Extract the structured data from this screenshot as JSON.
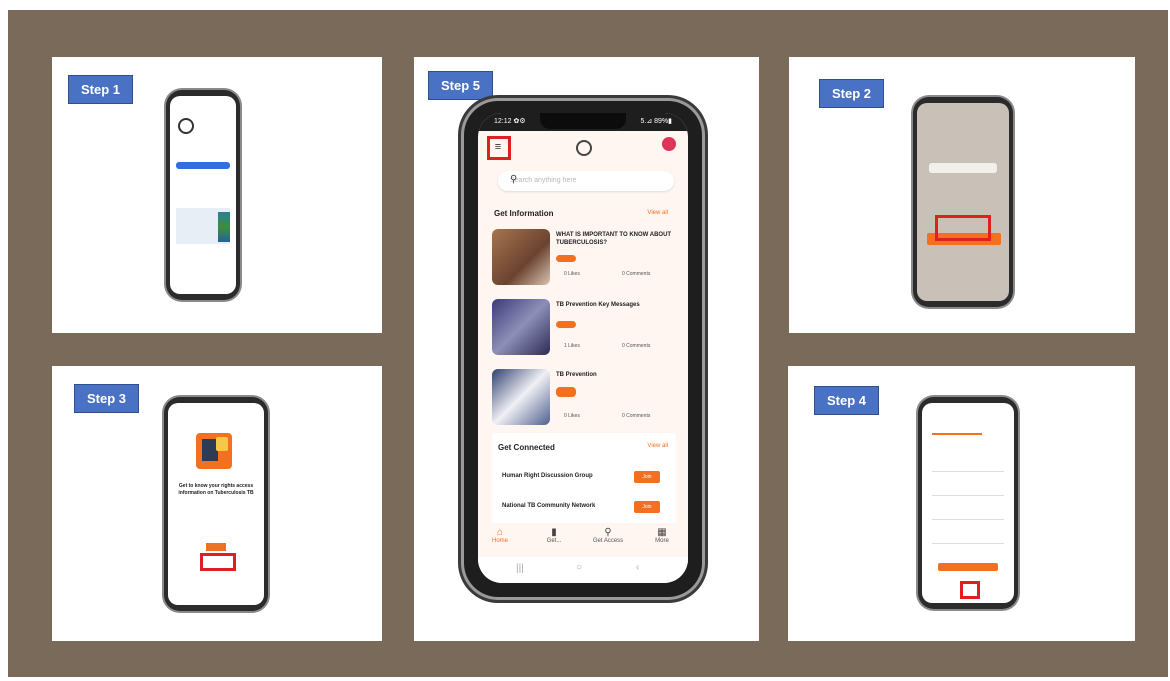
{
  "steps": {
    "step1": "Step 1",
    "step2": "Step 2",
    "step3": "Step 3",
    "step4": "Step 4",
    "step5": "Step 5"
  },
  "main_phone": {
    "status_left": "12:12 ✿⚙",
    "status_right": "5.⊿ 89%▮",
    "search_placeholder": "Search anything here",
    "get_information": "Get Information",
    "view_all": "View all",
    "articles": [
      {
        "title": "WHAT IS IMPORTANT TO KNOW ABOUT TUBERCULOSIS?",
        "likes": "0 Likes",
        "comments": "0 Comments"
      },
      {
        "title": "TB Prevention Key Messages",
        "likes": "1 Likes",
        "comments": "0 Comments"
      },
      {
        "title": "TB Prevention",
        "likes": "0 Likes",
        "comments": "0 Comments"
      }
    ],
    "get_connected": "Get Connected",
    "groups": [
      {
        "name": "Human Right Discussion Group",
        "action": "Join"
      },
      {
        "name": "National TB Community Network",
        "action": "Join"
      }
    ],
    "nav": [
      "Home",
      "Get...",
      "Get Access",
      "More"
    ]
  },
  "step3_screen": {
    "text": "Get to know your rights access information on Tuberculosis TB"
  },
  "colors": {
    "accent": "#f37021",
    "step_label": "#4a72c4",
    "background": "#7a6a59",
    "highlight": "#e02020"
  }
}
